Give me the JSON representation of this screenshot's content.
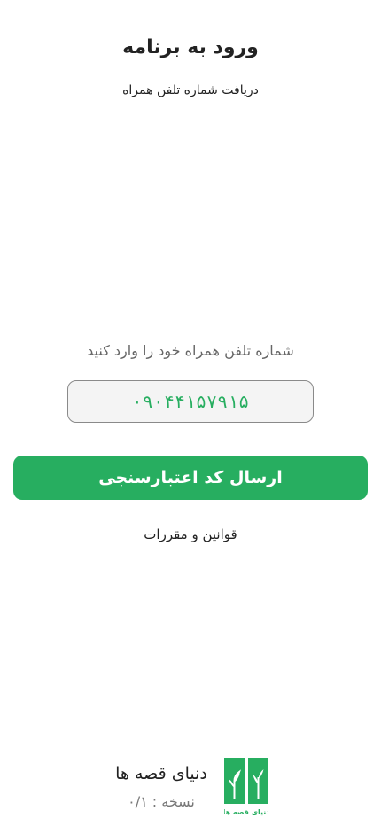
{
  "header": {
    "title": "ورود به برنامه",
    "subtitle": "دریافت شماره تلفن همراه"
  },
  "login": {
    "prompt": "شماره تلفن همراه خود را وارد کنید",
    "phone_value": "۰۹۰۴۴۱۵۷۹۱۵",
    "send_button_label": "ارسال کد اعتبارسنجی",
    "terms_label": "قوانین و مقررات"
  },
  "footer": {
    "app_name": "دنیای قصه ها",
    "version": "نسخه : ۰/۱",
    "logo_caption": "دنیای قصه ها"
  },
  "colors": {
    "accent": "#27ae60",
    "background": "#ffffff",
    "field_background": "#f4f4f4",
    "field_border": "#8a8a8a"
  }
}
